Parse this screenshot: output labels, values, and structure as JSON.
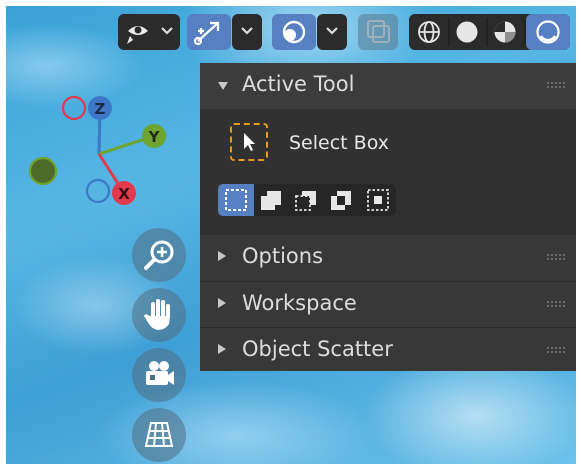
{
  "panel": {
    "active_tool_title": "Active Tool",
    "tool_name": "Select Box",
    "sections": [
      {
        "label": "Options"
      },
      {
        "label": "Workspace"
      },
      {
        "label": "Object Scatter"
      }
    ]
  },
  "gizmo": {
    "axis_z": "Z",
    "axis_y": "Y",
    "axis_x": "X",
    "colors": {
      "x": "#e13a4f",
      "y": "#6ea531",
      "z": "#3d78c8"
    }
  },
  "header": {
    "icons": [
      "visibility-eye-icon",
      "gizmo-arrows-icon",
      "overlays-icon",
      "xray-toggle-icon",
      "wireframe-shading-icon",
      "solid-shading-icon",
      "material-preview-icon",
      "rendered-shading-icon"
    ]
  },
  "accent": "#5680c2"
}
